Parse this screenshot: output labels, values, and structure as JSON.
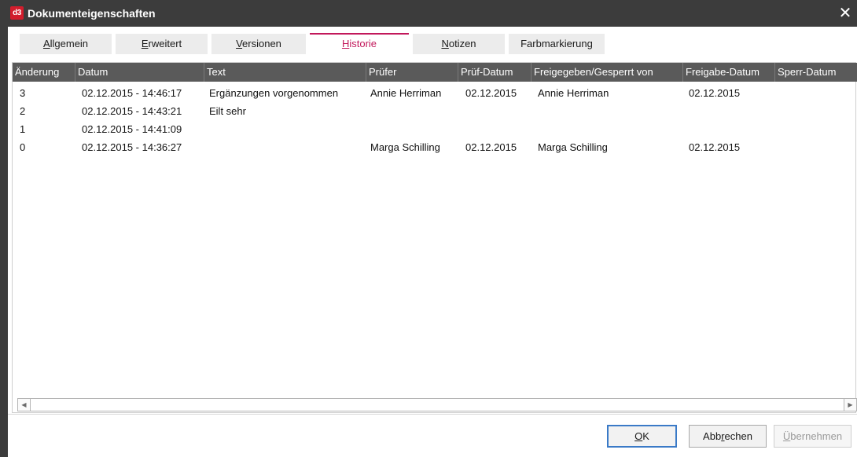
{
  "window": {
    "app_logo": "d3",
    "title": "Dokumenteigenschaften",
    "close_glyph": "✕"
  },
  "tabs": [
    {
      "pre": "",
      "u": "A",
      "post": "llgemein",
      "active": false
    },
    {
      "pre": "",
      "u": "E",
      "post": "rweitert",
      "active": false
    },
    {
      "pre": "",
      "u": "V",
      "post": "ersionen",
      "active": false
    },
    {
      "pre": "",
      "u": "H",
      "post": "istorie",
      "active": true
    },
    {
      "pre": "",
      "u": "N",
      "post": "otizen",
      "active": false
    },
    {
      "pre": "Farbmarkierung",
      "u": "",
      "post": "",
      "active": false
    }
  ],
  "table": {
    "headers": [
      "Änderung",
      "Datum",
      "Text",
      "Prüfer",
      "Prüf-Datum",
      "Freigegeben/Gesperrt von",
      "Freigabe-Datum",
      "Sperr-Datum"
    ],
    "rows": [
      [
        "3",
        "02.12.2015 - 14:46:17",
        "Ergänzungen vorgenommen",
        "Annie Herriman",
        "02.12.2015",
        "Annie Herriman",
        "02.12.2015",
        ""
      ],
      [
        "2",
        "02.12.2015 - 14:43:21",
        "Eilt sehr",
        "",
        "",
        "",
        "",
        ""
      ],
      [
        "1",
        "02.12.2015 - 14:41:09",
        "",
        "",
        "",
        "",
        "",
        ""
      ],
      [
        "0",
        "02.12.2015 - 14:36:27",
        "",
        "Marga Schilling",
        "02.12.2015",
        "Marga Schilling",
        "02.12.2015",
        ""
      ]
    ]
  },
  "scrollbar": {
    "left_arrow": "◀",
    "right_arrow": "▶"
  },
  "buttons": {
    "ok": {
      "pre": "",
      "u": "O",
      "post": "K"
    },
    "cancel": {
      "pre": "Abb",
      "u": "r",
      "post": "echen"
    },
    "apply": {
      "pre": "",
      "u": "Ü",
      "post": "bernehmen"
    }
  },
  "colors": {
    "titlebar": "#3c3c3c",
    "logo": "#d21d2c",
    "active_tab": "#c2185b",
    "header": "#5a5a5a"
  }
}
